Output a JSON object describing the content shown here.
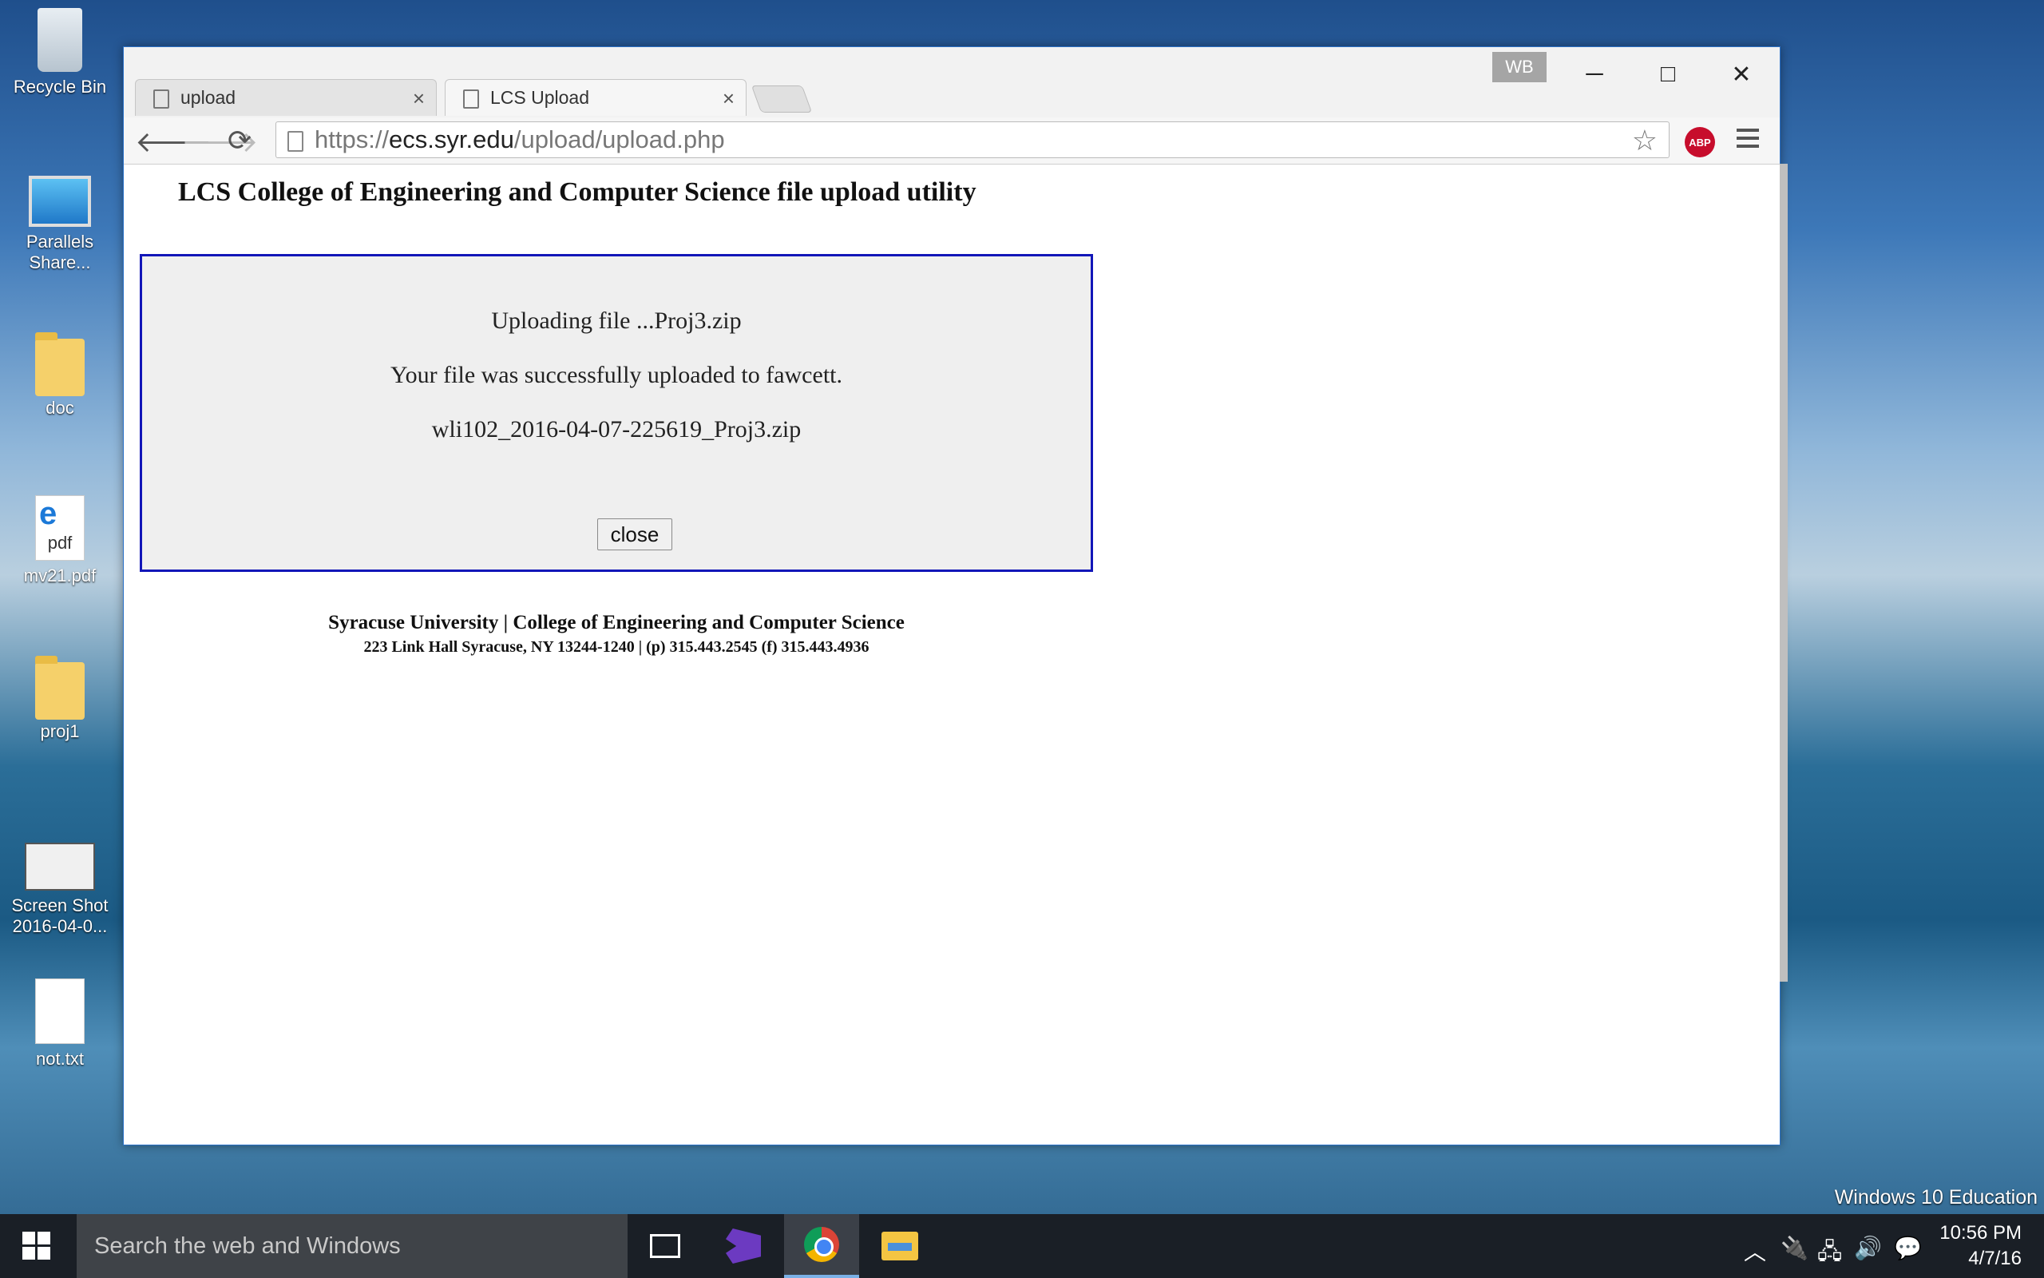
{
  "desktop": {
    "icons": [
      {
        "label": "Recycle Bin"
      },
      {
        "label": "Parallels Share..."
      },
      {
        "label": "doc"
      },
      {
        "label": "mv21.pdf",
        "badge": "pdf"
      },
      {
        "label": "proj1"
      },
      {
        "label": "Screen Shot 2016-04-0..."
      },
      {
        "label": "not.txt"
      }
    ],
    "watermark": "Windows 10 Education"
  },
  "browser": {
    "tabs": [
      {
        "label": "upload",
        "active": false
      },
      {
        "label": "LCS Upload",
        "active": true
      }
    ],
    "profile_badge": "WB",
    "url": {
      "scheme": "https://",
      "host": "ecs.syr.edu",
      "path": "/upload/upload.php"
    },
    "extension_label": "ABP"
  },
  "page": {
    "title": "LCS College of Engineering and Computer Science file upload utility",
    "panel": {
      "line1": "Uploading file ...Proj3.zip",
      "line2": "Your file was successfully uploaded to fawcett.",
      "line3": "wli102_2016-04-07-225619_Proj3.zip",
      "close_label": "close"
    },
    "footer": {
      "line1": "Syracuse University | College of Engineering and Computer Science",
      "line2": "223 Link Hall Syracuse, NY 13244-1240 | (p) 315.443.2545 (f) 315.443.4936"
    }
  },
  "taskbar": {
    "search_placeholder": "Search the web and Windows",
    "time": "10:56 PM",
    "date": "4/7/16"
  },
  "colors": {
    "panel_border": "#1216b8",
    "abp": "#c70d2c",
    "taskbar": "#1a1f26"
  }
}
